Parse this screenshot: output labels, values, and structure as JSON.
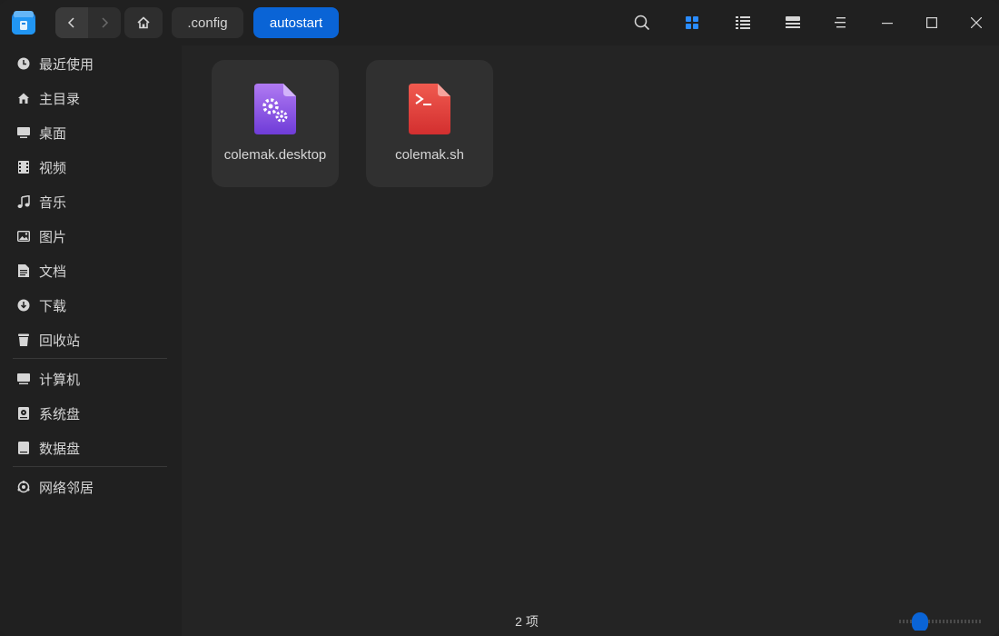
{
  "breadcrumb": {
    "items": [
      ".config",
      "autostart"
    ]
  },
  "sidebar": {
    "items": [
      {
        "label": "最近使用",
        "icon": "clock-icon"
      },
      {
        "label": "主目录",
        "icon": "home-icon"
      },
      {
        "label": "桌面",
        "icon": "desktop-icon"
      },
      {
        "label": "视频",
        "icon": "video-icon"
      },
      {
        "label": "音乐",
        "icon": "music-icon"
      },
      {
        "label": "图片",
        "icon": "image-icon"
      },
      {
        "label": "文档",
        "icon": "document-icon"
      },
      {
        "label": "下载",
        "icon": "download-icon"
      },
      {
        "label": "回收站",
        "icon": "trash-icon"
      },
      {
        "label": "计算机",
        "icon": "computer-icon"
      },
      {
        "label": "系统盘",
        "icon": "system-disk-icon"
      },
      {
        "label": "数据盘",
        "icon": "data-disk-icon"
      },
      {
        "label": "网络邻居",
        "icon": "network-icon"
      }
    ]
  },
  "files": [
    {
      "name": "colemak.desktop",
      "icon": "desktop-file-icon",
      "color": "#8a4de8"
    },
    {
      "name": "colemak.sh",
      "icon": "shell-script-icon",
      "color": "#e53935"
    }
  ],
  "status": {
    "count": "2 项"
  },
  "colors": {
    "accent": "#0a64d6",
    "background": "#242424",
    "sidebar": "#202020"
  },
  "view": {
    "mode": "icon",
    "zoom_level": 0.3
  }
}
